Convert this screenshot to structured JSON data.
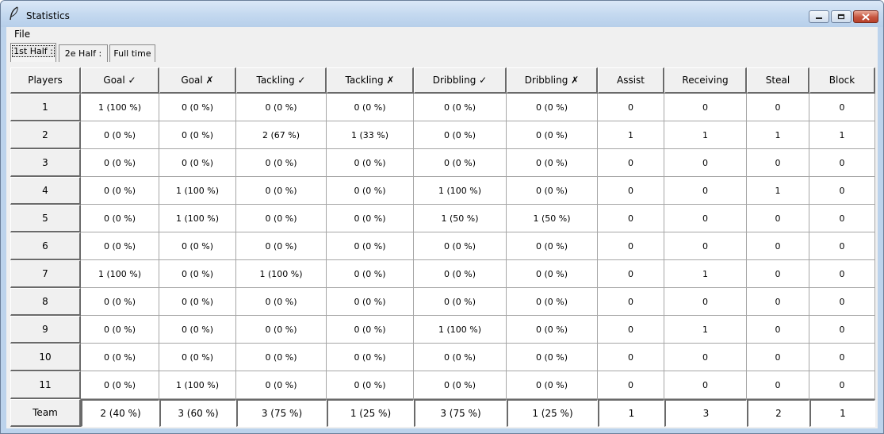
{
  "window": {
    "title": "Statistics"
  },
  "menu": {
    "file": "File"
  },
  "tabs": [
    {
      "label": "1st Half :",
      "active": true
    },
    {
      "label": "2e Half :",
      "active": false
    },
    {
      "label": "Full time",
      "active": false
    }
  ],
  "table": {
    "columns": [
      "Players",
      "Goal ✓",
      "Goal ✗",
      "Tackling ✓",
      "Tackling ✗",
      "Dribbling ✓",
      "Dribbling ✗",
      "Assist",
      "Receiving",
      "Steal",
      "Block"
    ],
    "rows": [
      [
        "1",
        "1 (100 %)",
        "0 (0 %)",
        "0 (0 %)",
        "0 (0 %)",
        "0 (0 %)",
        "0 (0 %)",
        "0",
        "0",
        "0",
        "0"
      ],
      [
        "2",
        "0 (0 %)",
        "0 (0 %)",
        "2 (67 %)",
        "1 (33 %)",
        "0 (0 %)",
        "0 (0 %)",
        "1",
        "1",
        "1",
        "1"
      ],
      [
        "3",
        "0 (0 %)",
        "0 (0 %)",
        "0 (0 %)",
        "0 (0 %)",
        "0 (0 %)",
        "0 (0 %)",
        "0",
        "0",
        "0",
        "0"
      ],
      [
        "4",
        "0 (0 %)",
        "1 (100 %)",
        "0 (0 %)",
        "0 (0 %)",
        "1 (100 %)",
        "0 (0 %)",
        "0",
        "0",
        "1",
        "0"
      ],
      [
        "5",
        "0 (0 %)",
        "1 (100 %)",
        "0 (0 %)",
        "0 (0 %)",
        "1 (50 %)",
        "1 (50 %)",
        "0",
        "0",
        "0",
        "0"
      ],
      [
        "6",
        "0 (0 %)",
        "0 (0 %)",
        "0 (0 %)",
        "0 (0 %)",
        "0 (0 %)",
        "0 (0 %)",
        "0",
        "0",
        "0",
        "0"
      ],
      [
        "7",
        "1 (100 %)",
        "0 (0 %)",
        "1 (100 %)",
        "0 (0 %)",
        "0 (0 %)",
        "0 (0 %)",
        "0",
        "1",
        "0",
        "0"
      ],
      [
        "8",
        "0 (0 %)",
        "0 (0 %)",
        "0 (0 %)",
        "0 (0 %)",
        "0 (0 %)",
        "0 (0 %)",
        "0",
        "0",
        "0",
        "0"
      ],
      [
        "9",
        "0 (0 %)",
        "0 (0 %)",
        "0 (0 %)",
        "0 (0 %)",
        "1 (100 %)",
        "0 (0 %)",
        "0",
        "1",
        "0",
        "0"
      ],
      [
        "10",
        "0 (0 %)",
        "0 (0 %)",
        "0 (0 %)",
        "0 (0 %)",
        "0 (0 %)",
        "0 (0 %)",
        "0",
        "0",
        "0",
        "0"
      ],
      [
        "11",
        "0 (0 %)",
        "1 (100 %)",
        "0 (0 %)",
        "0 (0 %)",
        "0 (0 %)",
        "0 (0 %)",
        "0",
        "0",
        "0",
        "0"
      ]
    ],
    "team": [
      "Team",
      "2 (40 %)",
      "3 (60 %)",
      "3 (75 %)",
      "1 (25 %)",
      "3 (75 %)",
      "1 (25 %)",
      "1",
      "3",
      "2",
      "1"
    ]
  },
  "icons": {
    "app": "feather-icon",
    "minimize": "minimize-icon",
    "maximize": "maximize-icon",
    "close": "close-icon"
  }
}
